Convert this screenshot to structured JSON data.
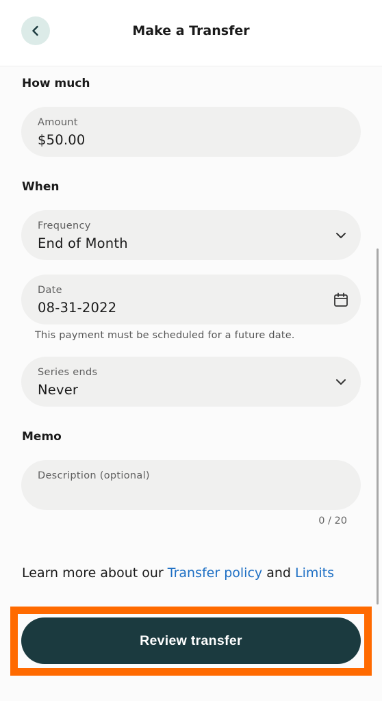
{
  "header": {
    "title": "Make a Transfer"
  },
  "sections": {
    "how_much": "How much",
    "when": "When",
    "memo": "Memo"
  },
  "amount": {
    "label": "Amount",
    "value": "$50.00"
  },
  "frequency": {
    "label": "Frequency",
    "value": "End of Month"
  },
  "date": {
    "label": "Date",
    "value": "08-31-2022",
    "helper": "This payment must be scheduled for a future date."
  },
  "series_ends": {
    "label": "Series ends",
    "value": "Never"
  },
  "memo": {
    "placeholder": "Description (optional)",
    "counter": "0 / 20"
  },
  "policy": {
    "prefix": "Learn more about our ",
    "transfer_policy_link": "Transfer policy",
    "middle": " and ",
    "limits_link": "Limits"
  },
  "footer": {
    "review_button": "Review transfer"
  },
  "colors": {
    "accent": "#1b3a3f",
    "link": "#1d6fc4",
    "highlight": "#ff6a00",
    "back_button_bg": "#dcebe8"
  },
  "icons": {
    "back": "chevron-left-icon",
    "dropdown": "chevron-down-icon",
    "calendar": "calendar-icon"
  }
}
